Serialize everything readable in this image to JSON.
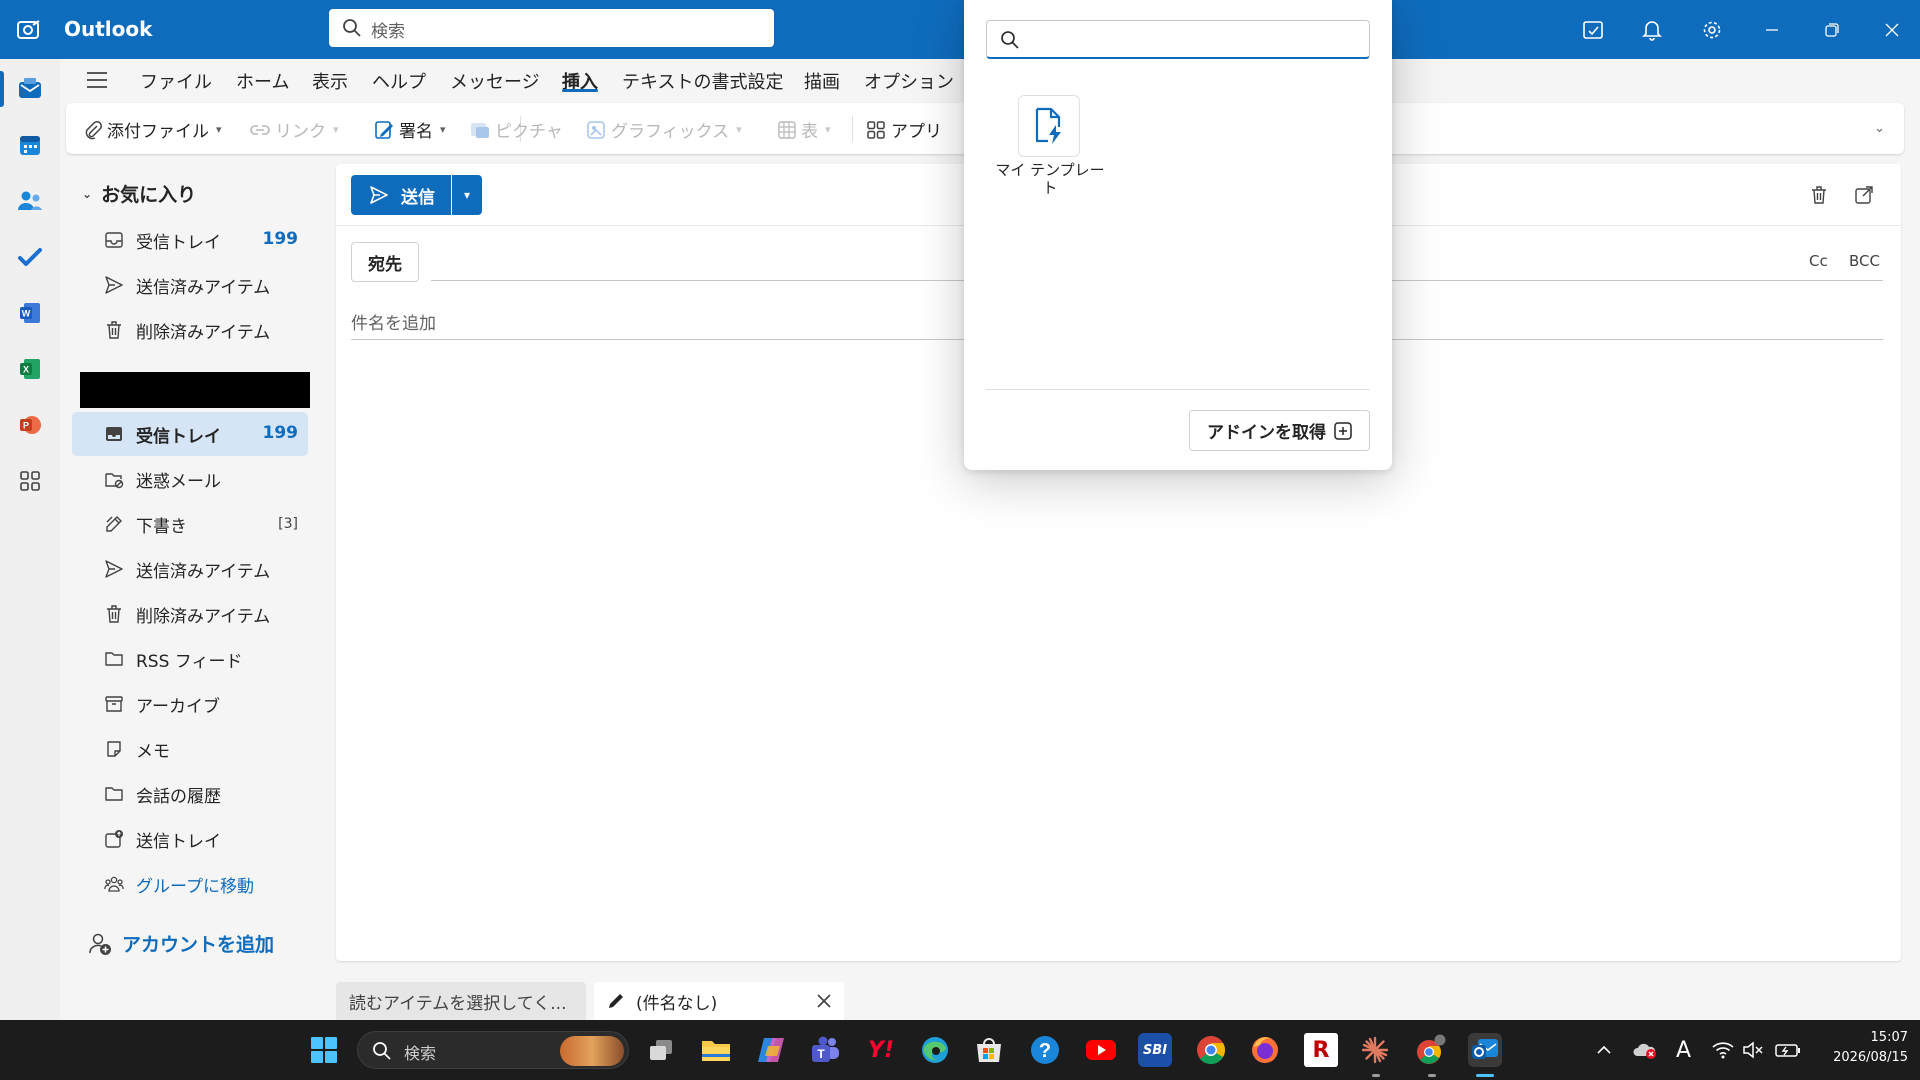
{
  "app": {
    "title": "Outlook"
  },
  "header_search": {
    "placeholder": "検索"
  },
  "menu": {
    "items": [
      "ファイル",
      "ホーム",
      "表示",
      "ヘルプ",
      "メッセージ",
      "挿入",
      "テキストの書式設定",
      "描画",
      "オプション"
    ],
    "active": "挿入"
  },
  "ribbon": {
    "attach": "添付ファイル",
    "link": "リンク",
    "signature": "署名",
    "picture": "ピクチャ",
    "graphics": "グラフィックス",
    "table": "表",
    "apps": "アプリ"
  },
  "favorites": {
    "header": "お気に入り",
    "items": [
      {
        "label": "受信トレイ",
        "count": "199",
        "icon": "inbox-icon"
      },
      {
        "label": "送信済みアイテム",
        "icon": "send-icon"
      },
      {
        "label": "削除済みアイテム",
        "icon": "trash-icon"
      }
    ]
  },
  "folders": {
    "items": [
      {
        "label": "受信トレイ",
        "count": "199",
        "icon": "inbox-icon",
        "selected": true
      },
      {
        "label": "迷惑メール",
        "icon": "junk-icon"
      },
      {
        "label": "下書き",
        "count": "[3]",
        "icon": "draft-icon"
      },
      {
        "label": "送信済みアイテム",
        "icon": "send-icon"
      },
      {
        "label": "削除済みアイテム",
        "icon": "trash-icon"
      },
      {
        "label": "RSS フィード",
        "icon": "folder-icon"
      },
      {
        "label": "アーカイブ",
        "icon": "archive-icon"
      },
      {
        "label": "メモ",
        "icon": "note-icon"
      },
      {
        "label": "会話の履歴",
        "icon": "folder-icon"
      },
      {
        "label": "送信トレイ",
        "icon": "outbox-icon"
      },
      {
        "label": "グループに移動",
        "icon": "group-icon"
      }
    ],
    "add_account": "アカウントを追加"
  },
  "compose": {
    "send": "送信",
    "to": "宛先",
    "cc": "Cc",
    "bcc": "BCC",
    "subject_placeholder": "件名を追加"
  },
  "bottom_tabs": [
    {
      "label": "読むアイテムを選択してく..."
    },
    {
      "label": "(件名なし)"
    }
  ],
  "apps_popup": {
    "search_placeholder": "",
    "apps": [
      {
        "label": "マイ テンプレート"
      }
    ],
    "get_addins": "アドインを取得"
  },
  "taskbar": {
    "search_placeholder": "検索",
    "ime": "A",
    "time": "15:07",
    "date": "2026/08/15"
  },
  "colors": {
    "accent": "#0f6cbd",
    "selected_bg": "#d6e5f5",
    "taskbar": "#1c1c1c"
  }
}
